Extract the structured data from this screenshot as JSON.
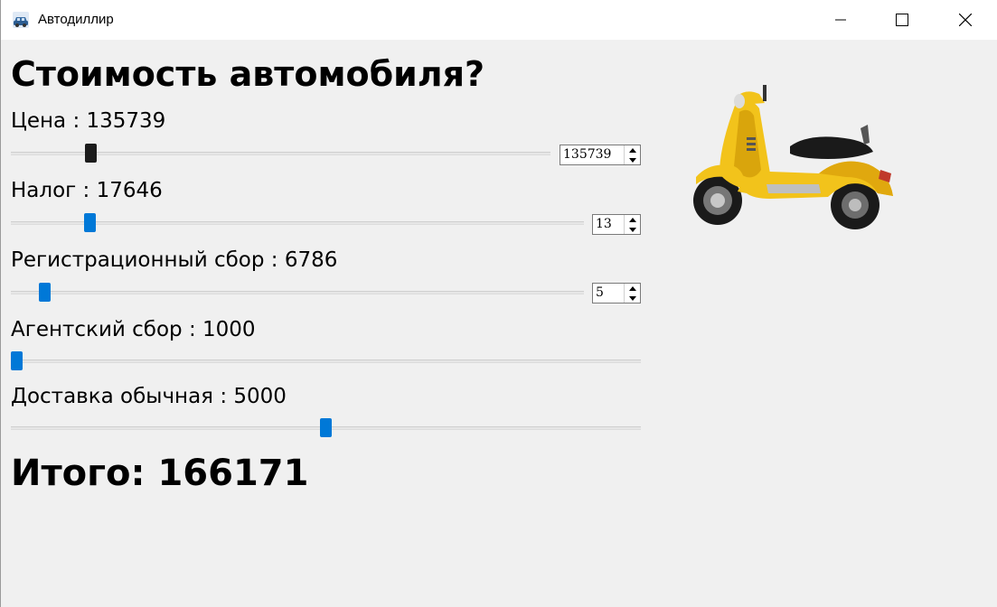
{
  "window": {
    "title": "Автодиллир"
  },
  "heading": "Стоимость автомобиля?",
  "fields": {
    "price": {
      "label": "Цена : 135739",
      "spin_value": "135739",
      "slider_level": 0.14
    },
    "tax": {
      "label": "Налог : 17646",
      "spin_value": "13",
      "slider_level": 0.13
    },
    "registration": {
      "label": "Регистрационный сбор : 6786",
      "spin_value": "5",
      "slider_level": 0.05
    },
    "agent": {
      "label": "Агентский сбор : 1000",
      "slider_level": 0.0
    },
    "delivery": {
      "label": "Доставка обычная : 5000",
      "slider_level": 0.5
    }
  },
  "total": "Итого: 166171",
  "image": {
    "icon": "scooter-image"
  },
  "colors": {
    "accent": "#0078d7",
    "scooter": "#f2c31b"
  }
}
